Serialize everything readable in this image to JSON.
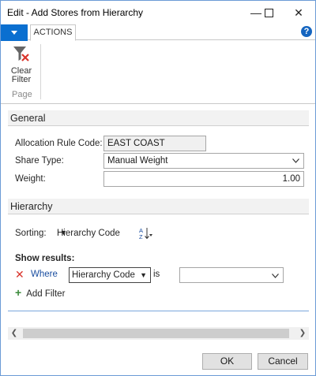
{
  "window": {
    "title": "Edit - Add Stores from Hierarchy"
  },
  "titlebar": {
    "minimize": "—",
    "maximize": "☐",
    "close": "✕"
  },
  "ribbon": {
    "tab_label": "ACTIONS",
    "help": "?",
    "clear_filter_label": "Clear Filter",
    "group_label": "Page"
  },
  "general": {
    "header": "General",
    "allocation_rule_code_label": "Allocation Rule Code:",
    "allocation_rule_code_value": "EAST COAST",
    "share_type_label": "Share Type:",
    "share_type_value": "Manual Weight",
    "weight_label": "Weight:",
    "weight_value": "1.00"
  },
  "hierarchy": {
    "header": "Hierarchy",
    "sorting_label": "Sorting:",
    "sorting_value": "Hierarchy Code",
    "show_results_label": "Show results:",
    "filter": {
      "where_label": "Where",
      "field_value": "Hierarchy Code",
      "operator_label": "is",
      "value": ""
    },
    "add_filter_label": "Add Filter"
  },
  "icons": {
    "clear_filter": "funnel-x-icon",
    "sort_order": "sort-az-icon",
    "remove_filter": "close-x-icon",
    "add_filter": "plus-icon"
  },
  "buttons": {
    "ok": "OK",
    "cancel": "Cancel"
  }
}
